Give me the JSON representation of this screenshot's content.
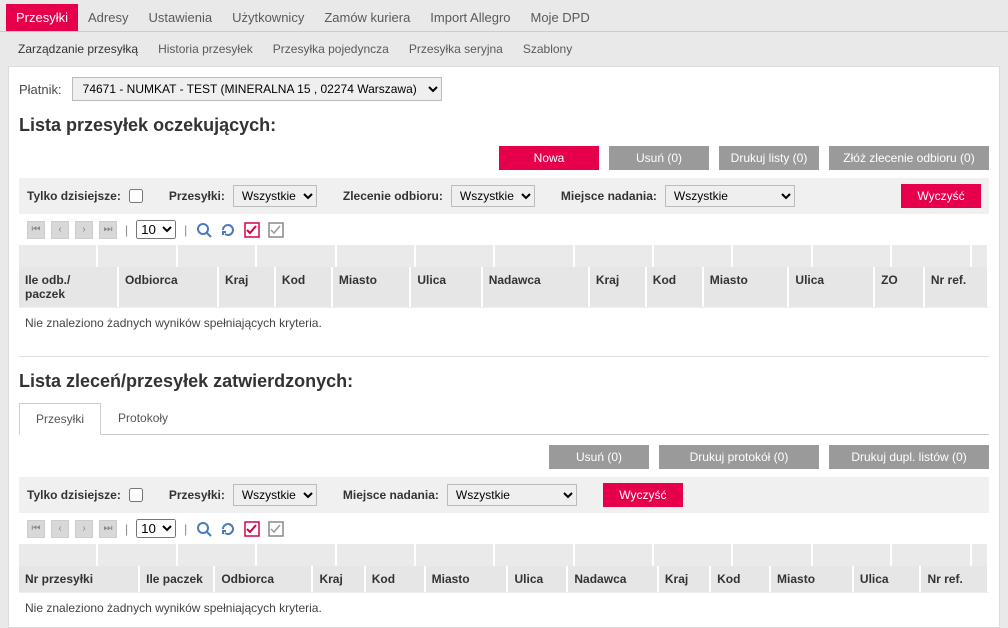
{
  "mainNav": {
    "items": [
      "Przesyłki",
      "Adresy",
      "Ustawienia",
      "Użytkownicy",
      "Zamów kuriera",
      "Import Allegro",
      "Moje DPD"
    ],
    "activeIndex": 0
  },
  "subNav": {
    "items": [
      "Zarządzanie przesyłką",
      "Historia przesyłek",
      "Przesyłka pojedyncza",
      "Przesyłka seryjna",
      "Szablony"
    ],
    "activeIndex": 0
  },
  "payer": {
    "label": "Płatnik:",
    "value": "74671 - NUMKAT - TEST (MINERALNA 15 , 02274 Warszawa)"
  },
  "pending": {
    "title": "Lista przesyłek oczekujących:",
    "actions": {
      "new": "Nowa",
      "delete": "Usuń (0)",
      "printLists": "Drukuj listy (0)",
      "placeOrder": "Złóż zlecenie odbioru (0)"
    },
    "filters": {
      "onlyTodayLabel": "Tylko dzisiejsze:",
      "shipmentsLabel": "Przesyłki:",
      "shipmentsValue": "Wszystkie",
      "collectOrderLabel": "Zlecenie odbioru:",
      "collectOrderValue": "Wszystkie",
      "shipFromLabel": "Miejsce nadania:",
      "shipFromValue": "Wszystkie",
      "clear": "Wyczyść"
    },
    "pageSize": "10",
    "columns": [
      "Ile odb./ paczek",
      "Odbiorca",
      "Kraj",
      "Kod",
      "Miasto",
      "Ulica",
      "Nadawca",
      "Kraj",
      "Kod",
      "Miasto",
      "Ulica",
      "ZO",
      "Nr ref."
    ],
    "noResults": "Nie znaleziono żadnych wyników spełniających kryteria."
  },
  "confirmed": {
    "title": "Lista zleceń/przesyłek zatwierdzonych:",
    "tabs": [
      "Przesyłki",
      "Protokoły"
    ],
    "tabActive": 0,
    "actions": {
      "delete": "Usuń (0)",
      "printProtocol": "Drukuj protokół (0)",
      "printDupl": "Drukuj dupl. listów (0)"
    },
    "filters": {
      "onlyTodayLabel": "Tylko dzisiejsze:",
      "shipmentsLabel": "Przesyłki:",
      "shipmentsValue": "Wszystkie",
      "shipFromLabel": "Miejsce nadania:",
      "shipFromValue": "Wszystkie",
      "clear": "Wyczyść"
    },
    "pageSize": "10",
    "columns": [
      "Nr przesyłki",
      "Ile paczek",
      "Odbiorca",
      "Kraj",
      "Kod",
      "Miasto",
      "Ulica",
      "Nadawca",
      "Kraj",
      "Kod",
      "Miasto",
      "Ulica",
      "Nr ref."
    ],
    "noResults": "Nie znaleziono żadnych wyników spełniających kryteria."
  }
}
